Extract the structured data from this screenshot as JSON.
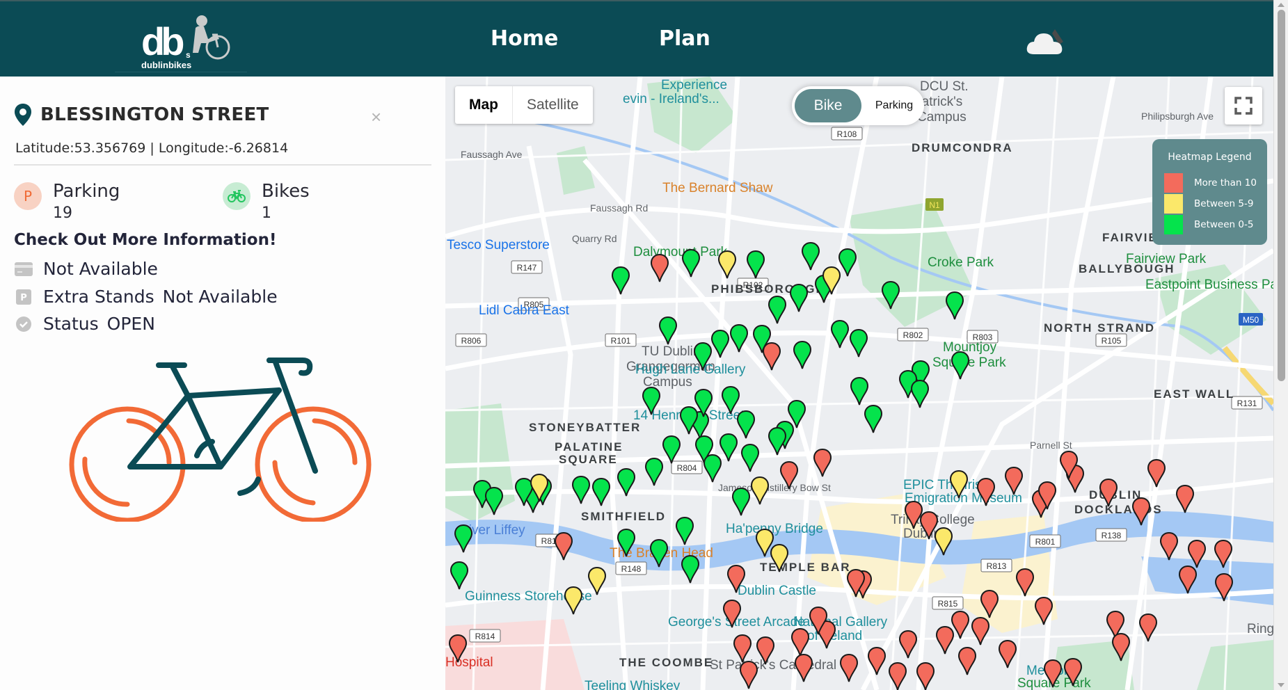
{
  "header": {
    "logo_text": "dublinbikes",
    "logo_mark": "db",
    "logo_sub": "s",
    "nav": [
      {
        "label": "Home"
      },
      {
        "label": "Plan"
      }
    ],
    "weather_icon": "cloud-night-icon"
  },
  "station": {
    "name": "BLESSINGTON STREET",
    "coords_text": "Latitude:53.356769 | Longitude:-6.26814",
    "latitude": "53.356769",
    "longitude": "-6.26814",
    "parking_label": "Parking",
    "parking_value": "19",
    "parking_icon_letter": "P",
    "bikes_label": "Bikes",
    "bikes_value": "1",
    "more_heading": "Check Out More Information!",
    "card_text": "Not Available",
    "extra_stands_label": "Extra Stands",
    "extra_stands_value": "Not Available",
    "status_label": "Status",
    "status_value": "OPEN",
    "close_glyph": "×"
  },
  "map": {
    "type_options": [
      {
        "label": "Map",
        "active": true
      },
      {
        "label": "Satellite",
        "active": false
      }
    ],
    "mode_toggle": {
      "bike_label": "Bike",
      "parking_label": "Parking",
      "selected": "Bike"
    },
    "legend": {
      "title": "Heatmap Legend",
      "items": [
        {
          "label": "More than 10",
          "color": "#f36b5c"
        },
        {
          "label": "Between 5-9",
          "color": "#fbe86a"
        },
        {
          "label": "Between 0-5",
          "color": "#05e34c"
        }
      ]
    },
    "labels": [
      {
        "text": "Experience Glasnevin - Ireland's...",
        "kind": "poi"
      },
      {
        "text": "DCU St. Patrick's Campus",
        "kind": "place"
      },
      {
        "text": "DRUMCONDRA",
        "kind": "area"
      },
      {
        "text": "Faussagh Ave",
        "kind": "street"
      },
      {
        "text": "Faussagh Rd",
        "kind": "street"
      },
      {
        "text": "Quarry Rd",
        "kind": "street"
      },
      {
        "text": "Philipsburgh Ave",
        "kind": "street"
      },
      {
        "text": "The Bernard Shaw",
        "kind": "bar"
      },
      {
        "text": "Tesco Superstore",
        "kind": "shop"
      },
      {
        "text": "Dalymount Park",
        "kind": "park"
      },
      {
        "text": "Croke Park",
        "kind": "park"
      },
      {
        "text": "FAIRVIEW",
        "kind": "area"
      },
      {
        "text": "Fairview Park",
        "kind": "park"
      },
      {
        "text": "BALLYBOUGH",
        "kind": "area"
      },
      {
        "text": "Eastpoint Business Park",
        "kind": "place"
      },
      {
        "text": "PHIBSBOROUGH",
        "kind": "area"
      },
      {
        "text": "Lidl Cabra East",
        "kind": "shop"
      },
      {
        "text": "NORTH STRAND",
        "kind": "area"
      },
      {
        "text": "Mountjoy Square Park",
        "kind": "park"
      },
      {
        "text": "TU Dublin, Grangegorman Campus",
        "kind": "place"
      },
      {
        "text": "Hugh Lane Gallery",
        "kind": "poi"
      },
      {
        "text": "EAST WALL",
        "kind": "area"
      },
      {
        "text": "14 Henrietta Street",
        "kind": "poi"
      },
      {
        "text": "STONEYBATTER",
        "kind": "area"
      },
      {
        "text": "PALATINE SQUARE",
        "kind": "area"
      },
      {
        "text": "Parnell St",
        "kind": "street"
      },
      {
        "text": "Jameson Distillery Bow St",
        "kind": "poi"
      },
      {
        "text": "EPIC The Irish Emigration Museum",
        "kind": "poi"
      },
      {
        "text": "DUBLIN DOCKLANDS",
        "kind": "area"
      },
      {
        "text": "SMITHFIELD",
        "kind": "area"
      },
      {
        "text": "River Liffey",
        "kind": "water"
      },
      {
        "text": "Ha'penny Bridge",
        "kind": "poi"
      },
      {
        "text": "Trinity College Dublin",
        "kind": "place"
      },
      {
        "text": "The Brazen Head",
        "kind": "bar"
      },
      {
        "text": "TEMPLE BAR",
        "kind": "area"
      },
      {
        "text": "Dublin Castle",
        "kind": "poi"
      },
      {
        "text": "Guinness Storehouse",
        "kind": "poi"
      },
      {
        "text": "George's Street Arcade",
        "kind": "poi"
      },
      {
        "text": "National Gallery of Ireland",
        "kind": "poi"
      },
      {
        "text": "THE COOMBE",
        "kind": "area"
      },
      {
        "text": "St Patrick's Cathedral",
        "kind": "place"
      },
      {
        "text": "Merrion Square Park",
        "kind": "park"
      },
      {
        "text": "Teeling Whiskey",
        "kind": "poi"
      },
      {
        "text": "Hospital",
        "kind": "hospital"
      },
      {
        "text": "Ringsend",
        "kind": "area"
      }
    ],
    "road_shields": [
      "R108",
      "N1",
      "R147",
      "R805",
      "R806",
      "R101",
      "R102",
      "R802",
      "R803",
      "R105",
      "M50",
      "R131",
      "R804",
      "R148",
      "R810",
      "R814",
      "R813",
      "R801",
      "R138",
      "R815"
    ],
    "marker_counts": {
      "red": 52,
      "yellow": 10,
      "green": 54
    }
  }
}
